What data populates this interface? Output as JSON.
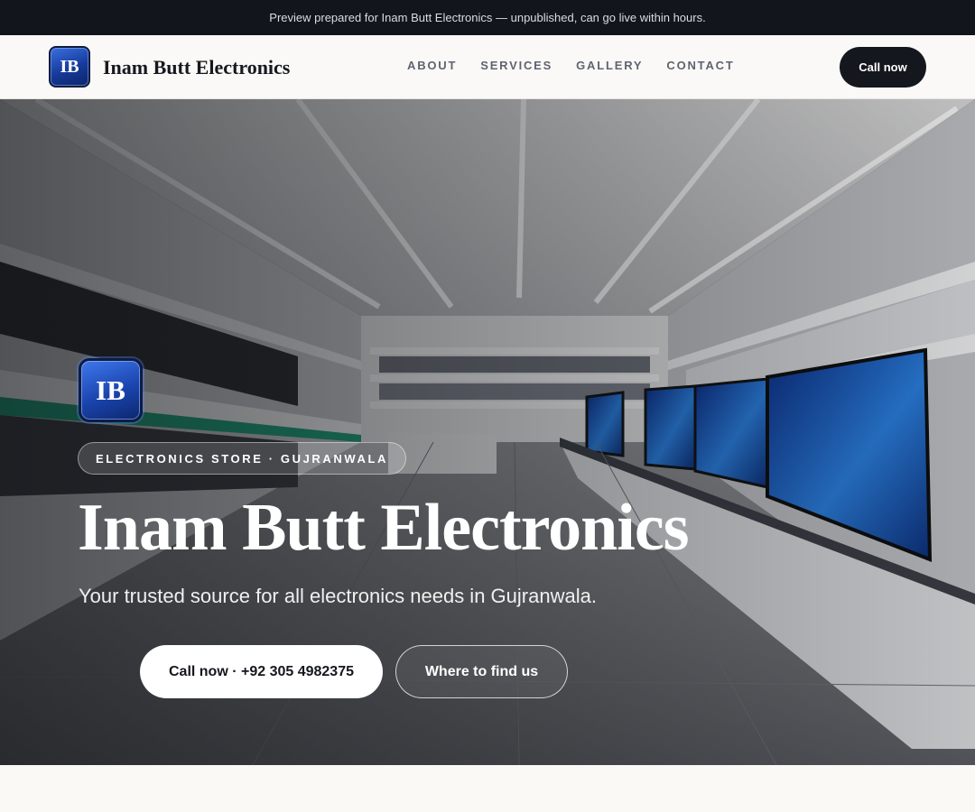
{
  "banner": {
    "text": "Preview prepared for Inam Butt Electronics — unpublished, can go live within hours."
  },
  "header": {
    "logo_initials": "IB",
    "brand_name": "Inam Butt Electronics",
    "nav": [
      {
        "label": "ABOUT"
      },
      {
        "label": "SERVICES"
      },
      {
        "label": "GALLERY"
      },
      {
        "label": "CONTACT"
      }
    ],
    "cta_label": "Call now"
  },
  "hero": {
    "logo_initials": "IB",
    "tag": "ELECTRONICS STORE · GUJRANWALA",
    "title": "Inam Butt Electronics",
    "subtitle": "Your trusted source for all electronics needs in Gujranwala.",
    "primary_button": "Call now · +92 305 4982375",
    "secondary_button": "Where to find us"
  },
  "colors": {
    "banner_bg": "#12151b",
    "accent_dark": "#14171d",
    "logo_blue": "#1a44ad"
  }
}
